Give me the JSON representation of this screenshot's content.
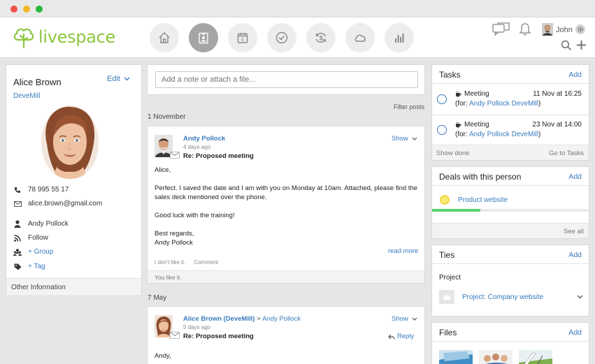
{
  "app": {
    "logo_text": "livespace",
    "user_name": "John",
    "accent_color": "#8cc63f",
    "link_color": "#3a7bbf"
  },
  "nav": [
    {
      "name": "home",
      "icon": "home-icon",
      "active": false
    },
    {
      "name": "contacts",
      "icon": "contact-card-icon",
      "active": true
    },
    {
      "name": "calendar",
      "icon": "calendar-icon",
      "active": false,
      "day": "6"
    },
    {
      "name": "tasks",
      "icon": "check-circle-icon",
      "active": false
    },
    {
      "name": "deals",
      "icon": "money-cycle-icon",
      "active": false
    },
    {
      "name": "cloud",
      "icon": "cloud-icon",
      "active": false
    },
    {
      "name": "reports",
      "icon": "bar-chart-icon",
      "active": false
    }
  ],
  "contact": {
    "name": "Alice Brown",
    "edit_label": "Edit",
    "company": "DeveMill",
    "phone": "78 995 55 17",
    "email": "alice.brown@gmail.com",
    "owner": "Andy Pollock",
    "follow_label": "Follow",
    "group_label": "+ Group",
    "tag_label": "+ Tag",
    "other_info_label": "Other Information"
  },
  "feed": {
    "note_placeholder": "Add a note or attach a file...",
    "filter_label": "Filter posts",
    "groups": [
      {
        "date": "1 November",
        "post": {
          "author": "Andy Pollock",
          "time": "4 days ago",
          "subject": "Re: Proposed meeting",
          "show_label": "Show",
          "body": [
            "Alice,",
            "Perfect. I saved the date and I am with you on Monday at 10am. Attached, please find the sales deck mentioned over the phone.",
            "Good luck with the training!",
            "Best regards,",
            "Andy Pollock"
          ],
          "read_more": "read more",
          "dislike_label": "I don't like it.",
          "comment_label": "Comment",
          "footer": "You like it."
        }
      },
      {
        "date": "7 May",
        "post": {
          "author": "Alice Brown (DeveMill)",
          "arrow": ">",
          "recipient": "Andy Pollock",
          "time": "5 days ago",
          "subject": "Re: Proposed meeting",
          "show_label": "Show",
          "reply_label": "Reply",
          "body": [
            "Andy,"
          ]
        }
      }
    ]
  },
  "tasks": {
    "title": "Tasks",
    "add_label": "Add",
    "items": [
      {
        "title": "Meeting",
        "date": "11 Nov at 16:25",
        "for_prefix": "(for:",
        "person": "Andy Pollock",
        "company": "DeveMill",
        "suffix": ")"
      },
      {
        "title": "Meeting",
        "date": "23 Nov at 14:00",
        "for_prefix": "(for:",
        "person": "Andy Pollock",
        "company": "DeveMill",
        "suffix": ")"
      }
    ],
    "show_done": "Show done",
    "go_to": "Go to Tasks"
  },
  "deals": {
    "title": "Deals with this person",
    "add_label": "Add",
    "deal_name": "Product website",
    "progress": 0.31,
    "see_all": "See all"
  },
  "ties": {
    "title": "Ties",
    "add_label": "Add",
    "section_label": "Project",
    "project_name": "Project: Company website"
  },
  "files": {
    "title": "Files",
    "add_label": "Add"
  }
}
